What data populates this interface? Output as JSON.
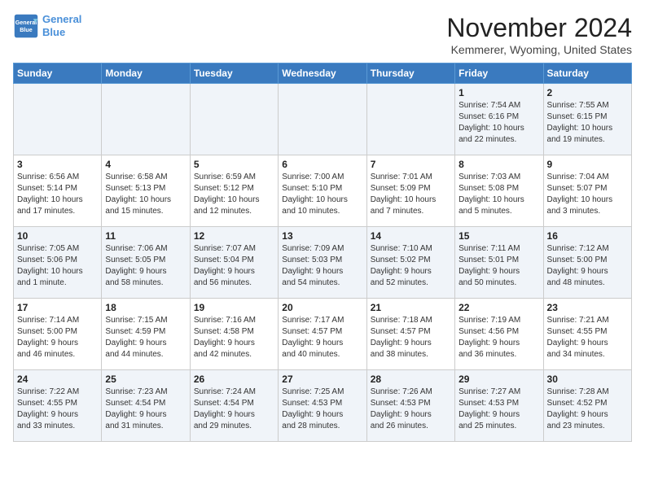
{
  "header": {
    "logo_line1": "General",
    "logo_line2": "Blue",
    "month": "November 2024",
    "location": "Kemmerer, Wyoming, United States"
  },
  "weekdays": [
    "Sunday",
    "Monday",
    "Tuesday",
    "Wednesday",
    "Thursday",
    "Friday",
    "Saturday"
  ],
  "weeks": [
    [
      {
        "day": "",
        "info": ""
      },
      {
        "day": "",
        "info": ""
      },
      {
        "day": "",
        "info": ""
      },
      {
        "day": "",
        "info": ""
      },
      {
        "day": "",
        "info": ""
      },
      {
        "day": "1",
        "info": "Sunrise: 7:54 AM\nSunset: 6:16 PM\nDaylight: 10 hours\nand 22 minutes."
      },
      {
        "day": "2",
        "info": "Sunrise: 7:55 AM\nSunset: 6:15 PM\nDaylight: 10 hours\nand 19 minutes."
      }
    ],
    [
      {
        "day": "3",
        "info": "Sunrise: 6:56 AM\nSunset: 5:14 PM\nDaylight: 10 hours\nand 17 minutes."
      },
      {
        "day": "4",
        "info": "Sunrise: 6:58 AM\nSunset: 5:13 PM\nDaylight: 10 hours\nand 15 minutes."
      },
      {
        "day": "5",
        "info": "Sunrise: 6:59 AM\nSunset: 5:12 PM\nDaylight: 10 hours\nand 12 minutes."
      },
      {
        "day": "6",
        "info": "Sunrise: 7:00 AM\nSunset: 5:10 PM\nDaylight: 10 hours\nand 10 minutes."
      },
      {
        "day": "7",
        "info": "Sunrise: 7:01 AM\nSunset: 5:09 PM\nDaylight: 10 hours\nand 7 minutes."
      },
      {
        "day": "8",
        "info": "Sunrise: 7:03 AM\nSunset: 5:08 PM\nDaylight: 10 hours\nand 5 minutes."
      },
      {
        "day": "9",
        "info": "Sunrise: 7:04 AM\nSunset: 5:07 PM\nDaylight: 10 hours\nand 3 minutes."
      }
    ],
    [
      {
        "day": "10",
        "info": "Sunrise: 7:05 AM\nSunset: 5:06 PM\nDaylight: 10 hours\nand 1 minute."
      },
      {
        "day": "11",
        "info": "Sunrise: 7:06 AM\nSunset: 5:05 PM\nDaylight: 9 hours\nand 58 minutes."
      },
      {
        "day": "12",
        "info": "Sunrise: 7:07 AM\nSunset: 5:04 PM\nDaylight: 9 hours\nand 56 minutes."
      },
      {
        "day": "13",
        "info": "Sunrise: 7:09 AM\nSunset: 5:03 PM\nDaylight: 9 hours\nand 54 minutes."
      },
      {
        "day": "14",
        "info": "Sunrise: 7:10 AM\nSunset: 5:02 PM\nDaylight: 9 hours\nand 52 minutes."
      },
      {
        "day": "15",
        "info": "Sunrise: 7:11 AM\nSunset: 5:01 PM\nDaylight: 9 hours\nand 50 minutes."
      },
      {
        "day": "16",
        "info": "Sunrise: 7:12 AM\nSunset: 5:00 PM\nDaylight: 9 hours\nand 48 minutes."
      }
    ],
    [
      {
        "day": "17",
        "info": "Sunrise: 7:14 AM\nSunset: 5:00 PM\nDaylight: 9 hours\nand 46 minutes."
      },
      {
        "day": "18",
        "info": "Sunrise: 7:15 AM\nSunset: 4:59 PM\nDaylight: 9 hours\nand 44 minutes."
      },
      {
        "day": "19",
        "info": "Sunrise: 7:16 AM\nSunset: 4:58 PM\nDaylight: 9 hours\nand 42 minutes."
      },
      {
        "day": "20",
        "info": "Sunrise: 7:17 AM\nSunset: 4:57 PM\nDaylight: 9 hours\nand 40 minutes."
      },
      {
        "day": "21",
        "info": "Sunrise: 7:18 AM\nSunset: 4:57 PM\nDaylight: 9 hours\nand 38 minutes."
      },
      {
        "day": "22",
        "info": "Sunrise: 7:19 AM\nSunset: 4:56 PM\nDaylight: 9 hours\nand 36 minutes."
      },
      {
        "day": "23",
        "info": "Sunrise: 7:21 AM\nSunset: 4:55 PM\nDaylight: 9 hours\nand 34 minutes."
      }
    ],
    [
      {
        "day": "24",
        "info": "Sunrise: 7:22 AM\nSunset: 4:55 PM\nDaylight: 9 hours\nand 33 minutes."
      },
      {
        "day": "25",
        "info": "Sunrise: 7:23 AM\nSunset: 4:54 PM\nDaylight: 9 hours\nand 31 minutes."
      },
      {
        "day": "26",
        "info": "Sunrise: 7:24 AM\nSunset: 4:54 PM\nDaylight: 9 hours\nand 29 minutes."
      },
      {
        "day": "27",
        "info": "Sunrise: 7:25 AM\nSunset: 4:53 PM\nDaylight: 9 hours\nand 28 minutes."
      },
      {
        "day": "28",
        "info": "Sunrise: 7:26 AM\nSunset: 4:53 PM\nDaylight: 9 hours\nand 26 minutes."
      },
      {
        "day": "29",
        "info": "Sunrise: 7:27 AM\nSunset: 4:53 PM\nDaylight: 9 hours\nand 25 minutes."
      },
      {
        "day": "30",
        "info": "Sunrise: 7:28 AM\nSunset: 4:52 PM\nDaylight: 9 hours\nand 23 minutes."
      }
    ]
  ]
}
